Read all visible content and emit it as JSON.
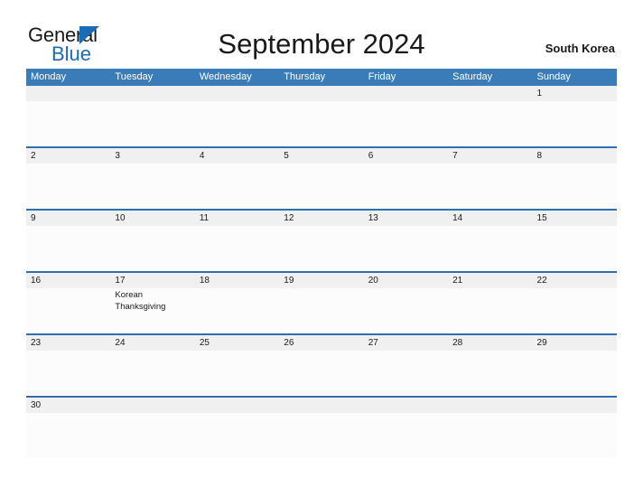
{
  "brand": {
    "logo_primary": "General",
    "logo_secondary": "Blue",
    "logo_mark": "triangle-icon"
  },
  "header": {
    "title": "September 2024",
    "region": "South Korea"
  },
  "calendar": {
    "weekday_headers": [
      "Monday",
      "Tuesday",
      "Wednesday",
      "Thursday",
      "Friday",
      "Saturday",
      "Sunday"
    ],
    "colors": {
      "header_blue": "#3a7cb8",
      "row_rule_blue": "#2f6fae",
      "date_band_gray": "#f0f0f0",
      "cell_background": "#fcfcfc",
      "logo_blue": "#1c6cb5",
      "text": "#1a1a1a"
    },
    "weeks": [
      {
        "days": [
          {
            "number": "",
            "empty": true,
            "events": []
          },
          {
            "number": "",
            "empty": true,
            "events": []
          },
          {
            "number": "",
            "empty": true,
            "events": []
          },
          {
            "number": "",
            "empty": true,
            "events": []
          },
          {
            "number": "",
            "empty": true,
            "events": []
          },
          {
            "number": "",
            "empty": true,
            "events": []
          },
          {
            "number": "1",
            "empty": false,
            "events": []
          }
        ]
      },
      {
        "days": [
          {
            "number": "2",
            "empty": false,
            "events": []
          },
          {
            "number": "3",
            "empty": false,
            "events": []
          },
          {
            "number": "4",
            "empty": false,
            "events": []
          },
          {
            "number": "5",
            "empty": false,
            "events": []
          },
          {
            "number": "6",
            "empty": false,
            "events": []
          },
          {
            "number": "7",
            "empty": false,
            "events": []
          },
          {
            "number": "8",
            "empty": false,
            "events": []
          }
        ]
      },
      {
        "days": [
          {
            "number": "9",
            "empty": false,
            "events": []
          },
          {
            "number": "10",
            "empty": false,
            "events": []
          },
          {
            "number": "11",
            "empty": false,
            "events": []
          },
          {
            "number": "12",
            "empty": false,
            "events": []
          },
          {
            "number": "13",
            "empty": false,
            "events": []
          },
          {
            "number": "14",
            "empty": false,
            "events": []
          },
          {
            "number": "15",
            "empty": false,
            "events": []
          }
        ]
      },
      {
        "days": [
          {
            "number": "16",
            "empty": false,
            "events": []
          },
          {
            "number": "17",
            "empty": false,
            "events": [
              "Korean Thanksgiving"
            ]
          },
          {
            "number": "18",
            "empty": false,
            "events": []
          },
          {
            "number": "19",
            "empty": false,
            "events": []
          },
          {
            "number": "20",
            "empty": false,
            "events": []
          },
          {
            "number": "21",
            "empty": false,
            "events": []
          },
          {
            "number": "22",
            "empty": false,
            "events": []
          }
        ]
      },
      {
        "days": [
          {
            "number": "23",
            "empty": false,
            "events": []
          },
          {
            "number": "24",
            "empty": false,
            "events": []
          },
          {
            "number": "25",
            "empty": false,
            "events": []
          },
          {
            "number": "26",
            "empty": false,
            "events": []
          },
          {
            "number": "27",
            "empty": false,
            "events": []
          },
          {
            "number": "28",
            "empty": false,
            "events": []
          },
          {
            "number": "29",
            "empty": false,
            "events": []
          }
        ]
      },
      {
        "days": [
          {
            "number": "30",
            "empty": false,
            "events": []
          },
          {
            "number": "",
            "empty": true,
            "events": []
          },
          {
            "number": "",
            "empty": true,
            "events": []
          },
          {
            "number": "",
            "empty": true,
            "events": []
          },
          {
            "number": "",
            "empty": true,
            "events": []
          },
          {
            "number": "",
            "empty": true,
            "events": []
          },
          {
            "number": "",
            "empty": true,
            "events": []
          }
        ]
      }
    ]
  }
}
